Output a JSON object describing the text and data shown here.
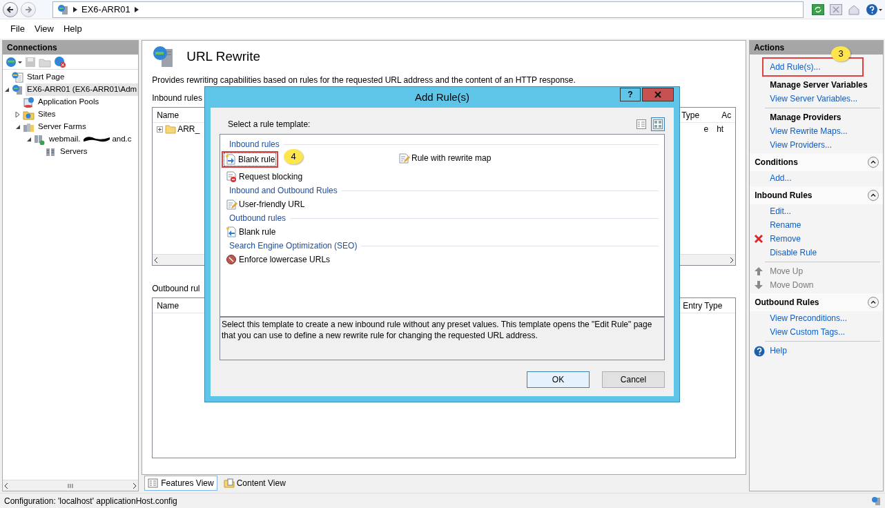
{
  "address_bar": {
    "crumbs": [
      "EX6-ARR01"
    ]
  },
  "menu": [
    "File",
    "View",
    "Help"
  ],
  "connections": {
    "title": "Connections",
    "tree": [
      {
        "label": "Start Page",
        "kind": "start",
        "selected": false
      },
      {
        "label": "EX6-ARR01 (EX6-ARR01\\Adm",
        "kind": "server",
        "selected": true,
        "expanded": true,
        "children": [
          {
            "label": "Application Pools",
            "kind": "pools",
            "selected": false
          },
          {
            "label": "Sites",
            "kind": "sites",
            "selected": false,
            "expanded": false
          },
          {
            "label": "Server Farms",
            "kind": "farms",
            "selected": false,
            "expanded": true,
            "children": [
              {
                "label": "webmail.",
                "label_tail": "and.c",
                "redacted": true,
                "kind": "farm",
                "selected": false,
                "expanded": true,
                "children": [
                  {
                    "label": "Servers",
                    "kind": "servers",
                    "selected": false
                  }
                ]
              }
            ]
          }
        ]
      }
    ]
  },
  "feature": {
    "title": "URL Rewrite",
    "description": "Provides rewriting capabilities based on rules for the requested URL address and the content of an HTTP response.",
    "inbound": {
      "label": "Inbound rules",
      "columns": [
        "Name",
        "Type",
        "Ac"
      ],
      "rows": [
        {
          "cells": [
            "ARR_",
            "e",
            "ht"
          ],
          "expanded": false
        }
      ]
    },
    "outbound": {
      "label": "Outbound rul",
      "columns": [
        "Name",
        "Entry Type"
      ]
    }
  },
  "view_tabs": [
    {
      "label": "Features View",
      "selected": true
    },
    {
      "label": "Content View",
      "selected": false
    }
  ],
  "actions": [
    {
      "kind": "header",
      "label": "Actions"
    },
    {
      "kind": "link",
      "label": "Add Rule(s)...",
      "callout": "3"
    },
    {
      "kind": "heading",
      "label": "Manage Server Variables"
    },
    {
      "kind": "link",
      "label": "View Server Variables..."
    },
    {
      "kind": "divider"
    },
    {
      "kind": "heading",
      "label": "Manage Providers"
    },
    {
      "kind": "link",
      "label": "View Rewrite Maps..."
    },
    {
      "kind": "link",
      "label": "View Providers..."
    },
    {
      "kind": "section",
      "label": "Conditions",
      "expanded": true
    },
    {
      "kind": "link",
      "label": "Add..."
    },
    {
      "kind": "section",
      "label": "Inbound Rules",
      "expanded": true
    },
    {
      "kind": "link",
      "label": "Edit..."
    },
    {
      "kind": "link",
      "label": "Rename"
    },
    {
      "kind": "remove",
      "label": "Remove"
    },
    {
      "kind": "link",
      "label": "Disable Rule"
    },
    {
      "kind": "divider"
    },
    {
      "kind": "move-up",
      "label": "Move Up",
      "disabled": true
    },
    {
      "kind": "move-down",
      "label": "Move Down",
      "disabled": true
    },
    {
      "kind": "section",
      "label": "Outbound Rules",
      "expanded": true
    },
    {
      "kind": "link",
      "label": "View Preconditions..."
    },
    {
      "kind": "link",
      "label": "View Custom Tags..."
    },
    {
      "kind": "divider"
    },
    {
      "kind": "help",
      "label": "Help"
    }
  ],
  "status_bar": "Configuration: 'localhost' applicationHost.config",
  "dialog": {
    "title": "Add Rule(s)",
    "help": "?",
    "prompt": "Select a rule template:",
    "views": [
      {
        "kind": "details",
        "selected": false
      },
      {
        "kind": "tiles",
        "selected": true
      }
    ],
    "groups": [
      {
        "title": "Inbound rules",
        "items": [
          {
            "label": "Blank rule",
            "kind": "blank-in",
            "selected": true,
            "callout": "4"
          },
          {
            "label": "Rule with rewrite map",
            "kind": "map",
            "selected": false
          },
          {
            "label": "Request blocking",
            "kind": "block",
            "selected": false
          }
        ]
      },
      {
        "title": "Inbound and Outbound Rules",
        "items": [
          {
            "label": "User-friendly URL",
            "kind": "map",
            "selected": false
          }
        ]
      },
      {
        "title": "Outbound rules",
        "items": [
          {
            "label": "Blank rule",
            "kind": "blank-out",
            "selected": false
          }
        ]
      },
      {
        "title": "Search Engine Optimization (SEO)",
        "items": [
          {
            "label": "Enforce lowercase URLs",
            "kind": "lower",
            "selected": false
          }
        ]
      }
    ],
    "description": "Select this template to create a new inbound rule without any preset values. This template opens the \"Edit Rule\" page that you can use to define a new rewrite rule for changing the requested URL address.",
    "buttons": [
      {
        "label": "OK",
        "default": true
      },
      {
        "label": "Cancel",
        "default": false
      }
    ]
  }
}
